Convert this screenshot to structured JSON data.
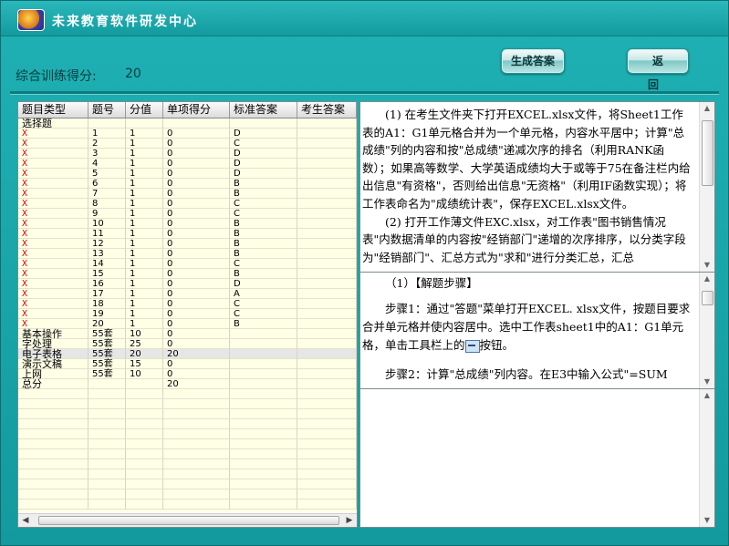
{
  "app": {
    "title": "未来教育软件研发中心"
  },
  "score": {
    "label": "综合训练得分:",
    "value": "20"
  },
  "buttons": {
    "generate": "生成答案",
    "back": "返 回"
  },
  "grid": {
    "columns": [
      "题目类型",
      "题号",
      "分值",
      "单项得分",
      "标准答案",
      "考生答案"
    ],
    "rows": [
      {
        "type": "选择题",
        "no": "",
        "value": "",
        "score": "",
        "std": "",
        "ans": "",
        "mark": ""
      },
      {
        "type": "X",
        "no": "1",
        "value": "1",
        "score": "0",
        "std": "D",
        "ans": "",
        "mark": "red"
      },
      {
        "type": "X",
        "no": "2",
        "value": "1",
        "score": "0",
        "std": "C",
        "ans": "",
        "mark": "red"
      },
      {
        "type": "X",
        "no": "3",
        "value": "1",
        "score": "0",
        "std": "D",
        "ans": "",
        "mark": "red"
      },
      {
        "type": "X",
        "no": "4",
        "value": "1",
        "score": "0",
        "std": "D",
        "ans": "",
        "mark": "red"
      },
      {
        "type": "X",
        "no": "5",
        "value": "1",
        "score": "0",
        "std": "D",
        "ans": "",
        "mark": "red"
      },
      {
        "type": "X",
        "no": "6",
        "value": "1",
        "score": "0",
        "std": "B",
        "ans": "",
        "mark": "red"
      },
      {
        "type": "X",
        "no": "7",
        "value": "1",
        "score": "0",
        "std": "B",
        "ans": "",
        "mark": "red"
      },
      {
        "type": "X",
        "no": "8",
        "value": "1",
        "score": "0",
        "std": "C",
        "ans": "",
        "mark": "red"
      },
      {
        "type": "X",
        "no": "9",
        "value": "1",
        "score": "0",
        "std": "C",
        "ans": "",
        "mark": "red"
      },
      {
        "type": "X",
        "no": "10",
        "value": "1",
        "score": "0",
        "std": "B",
        "ans": "",
        "mark": "red"
      },
      {
        "type": "X",
        "no": "11",
        "value": "1",
        "score": "0",
        "std": "B",
        "ans": "",
        "mark": "red"
      },
      {
        "type": "X",
        "no": "12",
        "value": "1",
        "score": "0",
        "std": "B",
        "ans": "",
        "mark": "red"
      },
      {
        "type": "X",
        "no": "13",
        "value": "1",
        "score": "0",
        "std": "B",
        "ans": "",
        "mark": "red"
      },
      {
        "type": "X",
        "no": "14",
        "value": "1",
        "score": "0",
        "std": "C",
        "ans": "",
        "mark": "red"
      },
      {
        "type": "X",
        "no": "15",
        "value": "1",
        "score": "0",
        "std": "B",
        "ans": "",
        "mark": "red"
      },
      {
        "type": "X",
        "no": "16",
        "value": "1",
        "score": "0",
        "std": "D",
        "ans": "",
        "mark": "red"
      },
      {
        "type": "X",
        "no": "17",
        "value": "1",
        "score": "0",
        "std": "A",
        "ans": "",
        "mark": "red"
      },
      {
        "type": "X",
        "no": "18",
        "value": "1",
        "score": "0",
        "std": "C",
        "ans": "",
        "mark": "red"
      },
      {
        "type": "X",
        "no": "19",
        "value": "1",
        "score": "0",
        "std": "C",
        "ans": "",
        "mark": "red"
      },
      {
        "type": "X",
        "no": "20",
        "value": "1",
        "score": "0",
        "std": "B",
        "ans": "",
        "mark": "red"
      },
      {
        "type": "基本操作",
        "no": "55套",
        "value": "10",
        "score": "0",
        "std": "",
        "ans": "",
        "mark": ""
      },
      {
        "type": "字处理",
        "no": "55套",
        "value": "25",
        "score": "0",
        "std": "",
        "ans": "",
        "mark": ""
      },
      {
        "type": "电子表格",
        "no": "55套",
        "value": "20",
        "score": "20",
        "std": "",
        "ans": "",
        "mark": "highlight"
      },
      {
        "type": "演示文稿",
        "no": "55套",
        "value": "15",
        "score": "0",
        "std": "",
        "ans": "",
        "mark": ""
      },
      {
        "type": "上网",
        "no": "55套",
        "value": "10",
        "score": "0",
        "std": "",
        "ans": "",
        "mark": ""
      },
      {
        "type": "总分",
        "no": "",
        "value": "",
        "score": "20",
        "std": "",
        "ans": "",
        "mark": ""
      }
    ]
  },
  "question": {
    "paragraphs": [
      "(1) 在考生文件夹下打开EXCEL.xlsx文件，将Sheet1工作表的A1：G1单元格合并为一个单元格，内容水平居中；计算\"总成绩\"列的内容和按\"总成绩\"递减次序的排名（利用RANK函数）；如果高等数学、大学英语成绩均大于或等于75在备注栏内给出信息\"有资格\"，否则给出信息\"无资格\"（利用IF函数实现）；将工作表命名为\"成绩统计表\"，保存EXCEL.xlsx文件。",
      "(2) 打开工作薄文件EXC.xlsx，对工作表\"图书销售情况表\"内数据清单的内容按\"经销部门\"递增的次序排序，以分类字段为\"经销部门\"、汇总方式为\"求和\"进行分类汇总，汇总"
    ]
  },
  "answer": {
    "heading": "（1）【解题步骤】",
    "step1_a": "步骤1：通过\"答题\"菜单打开EXCEL. xlsx文件，按题目要求合并单元格并使内容居中。选中工作表sheet1中的A1：G1单元格，单击工具栏上的",
    "step1_b": "按钮。",
    "step2": "步骤2：计算\"总成绩\"列内容。在E3中输入公式\"=SUM"
  },
  "icons": [
    "app-logo-icon",
    "merge-center-icon",
    "scroll-up-icon",
    "scroll-down-icon",
    "scroll-left-icon",
    "scroll-right-icon"
  ]
}
